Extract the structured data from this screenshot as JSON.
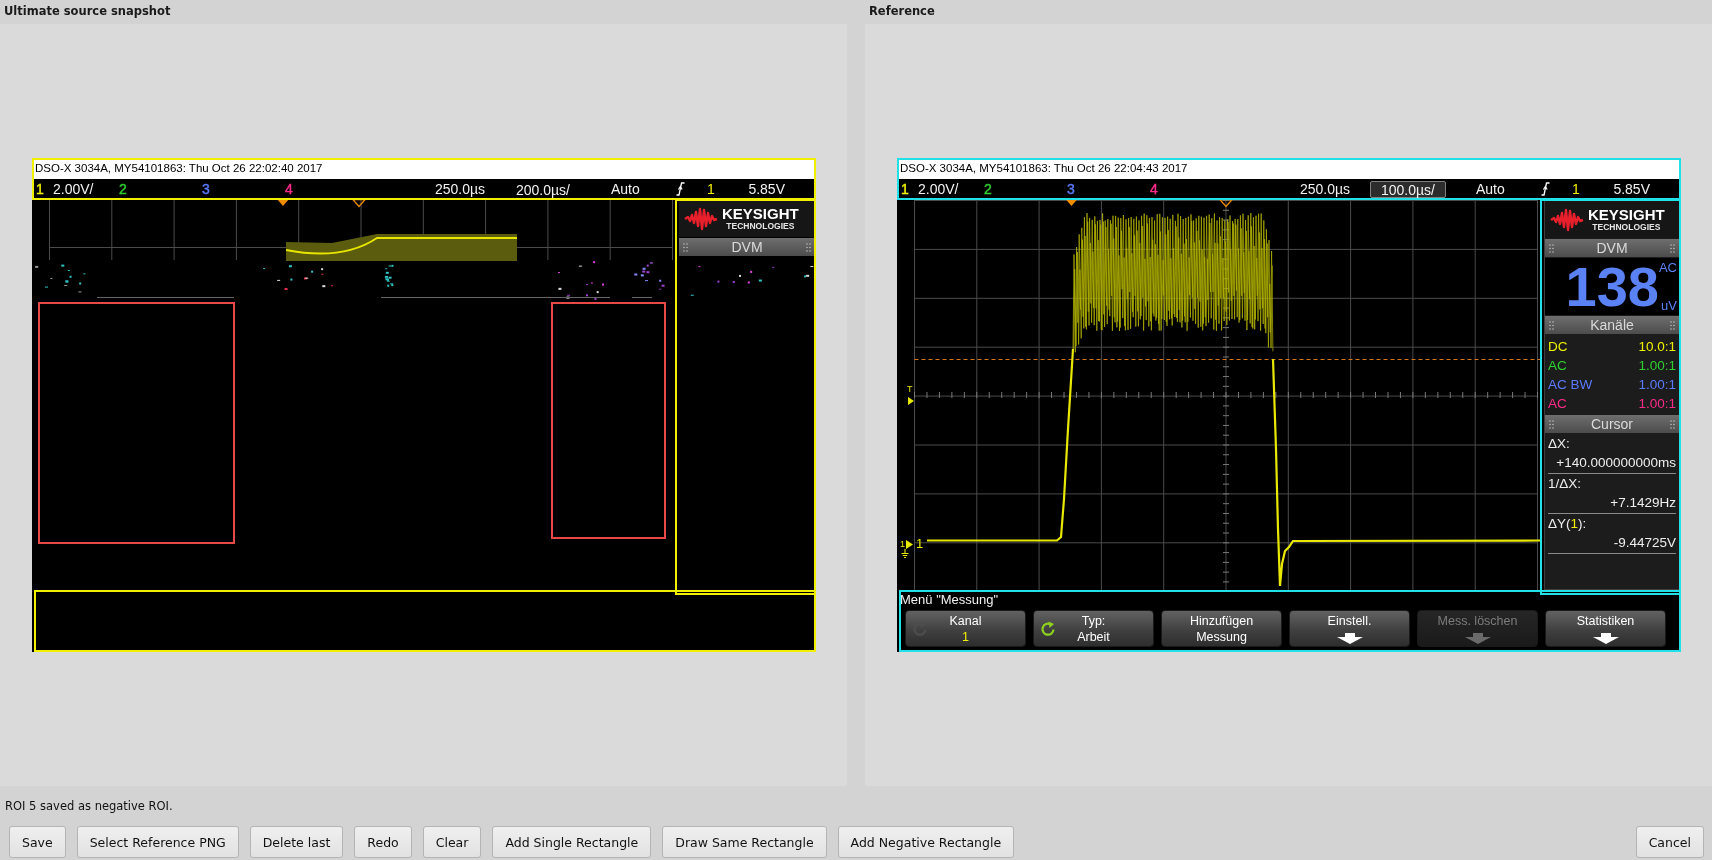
{
  "panels": [
    {
      "title": "Ultimate source snapshot",
      "scope": {
        "kind": "corrupted",
        "title": "DSO-X 3034A, MY54101863: Thu Oct 26 22:02:40 2017",
        "status": {
          "channels": [
            {
              "number": "1",
              "color": "#f0f000",
              "scale": "2.00V/"
            },
            {
              "number": "2",
              "color": "#30d030"
            },
            {
              "number": "3",
              "color": "#5b7bff"
            },
            {
              "number": "4",
              "color": "#ff2a8a"
            }
          ],
          "delay": "250.0µs",
          "timebase": {
            "text": "200.0µs/",
            "active": false
          },
          "mode": "Auto",
          "trigger_source": {
            "text": "1",
            "color": "#f0f000"
          },
          "trigger_level": "5.85V"
        },
        "side_panel": {
          "logo": {
            "name": "KEYSIGHT",
            "tagline": "TECHNOLOGIES"
          },
          "dvm": {
            "title": "DVM"
          }
        },
        "rois": [
          {
            "color": "#f0f000"
          },
          {
            "color": "#f0f000"
          },
          {
            "color": "#f0f000"
          },
          {
            "color": "#e84848"
          },
          {
            "color": "#e84848"
          }
        ]
      }
    },
    {
      "title": "Reference",
      "scope": {
        "kind": "signal",
        "title": "DSO-X 3034A, MY54101863: Thu Oct 26 22:04:43 2017",
        "status": {
          "channels": [
            {
              "number": "1",
              "color": "#f0f000",
              "scale": "2.00V/"
            },
            {
              "number": "2",
              "color": "#30d030"
            },
            {
              "number": "3",
              "color": "#5b7bff"
            },
            {
              "number": "4",
              "color": "#ff2a8a"
            }
          ],
          "delay": "250.0µs",
          "timebase": {
            "text": "100.0µs/",
            "active": true
          },
          "mode": "Auto",
          "trigger_source": {
            "text": "1",
            "color": "#f0f000"
          },
          "trigger_level": "5.85V"
        },
        "display": {
          "trigger_marker": "T",
          "channel_marker": "1",
          "trace_label": "1"
        },
        "side_panel": {
          "logo": {
            "name": "KEYSIGHT",
            "tagline": "TECHNOLOGIES"
          },
          "dvm": {
            "title": "DVM",
            "reading": "138",
            "mode": "AC",
            "unit": "uV"
          },
          "channels": {
            "title": "Kanäle",
            "rows": [
              {
                "coupling": "DC",
                "probe": "10.0:1",
                "color": "#f0f000"
              },
              {
                "coupling": "AC",
                "probe": "1.00:1",
                "color": "#30d030"
              },
              {
                "coupling": "AC BW",
                "probe": "1.00:1",
                "color": "#5b7bff"
              },
              {
                "coupling": "AC",
                "probe": "1.00:1",
                "color": "#ff2a8a"
              }
            ]
          },
          "cursor": {
            "title": "Cursor",
            "items": [
              {
                "label": "ΔX:",
                "value": "+140.000000000ms"
              },
              {
                "label": "1/ΔX:",
                "value": "+7.1429Hz"
              },
              {
                "label": "ΔY(",
                "source": "1",
                "label_end": "):",
                "color": "#f0f000",
                "value": "-9.44725V"
              }
            ]
          }
        },
        "menu": {
          "title": "Menü \"Messung\"",
          "softkeys": [
            {
              "kind": "knob",
              "label": "Kanal",
              "value": "1",
              "color": "#f0f000",
              "knob_active": false,
              "disabled": false
            },
            {
              "kind": "knob",
              "label": "Typ:",
              "value": "Arbeit",
              "color": "#ffffff",
              "knob_active": true,
              "disabled": false
            },
            {
              "kind": "value",
              "label": "Hinzufügen",
              "value": "Messung",
              "color": "#ffffff",
              "disabled": false
            },
            {
              "kind": "submenu",
              "label": "Einstell.",
              "disabled": false
            },
            {
              "kind": "submenu",
              "label": "Mess. löschen",
              "disabled": true
            },
            {
              "kind": "submenu",
              "label": "Statistiken",
              "disabled": false
            }
          ]
        },
        "rois": [
          {
            "color": "#20e0e8"
          },
          {
            "color": "#20e0e8"
          },
          {
            "color": "#20e0e8"
          }
        ]
      }
    }
  ],
  "status_message": "ROI 5 saved as negative ROI.",
  "buttons": [
    "Save",
    "Select Reference PNG",
    "Delete last",
    "Redo",
    "Clear",
    "Add Single Rectangle",
    "Draw Same Rectangle",
    "Add Negative Rectangle"
  ],
  "cancel_button": "Cancel"
}
